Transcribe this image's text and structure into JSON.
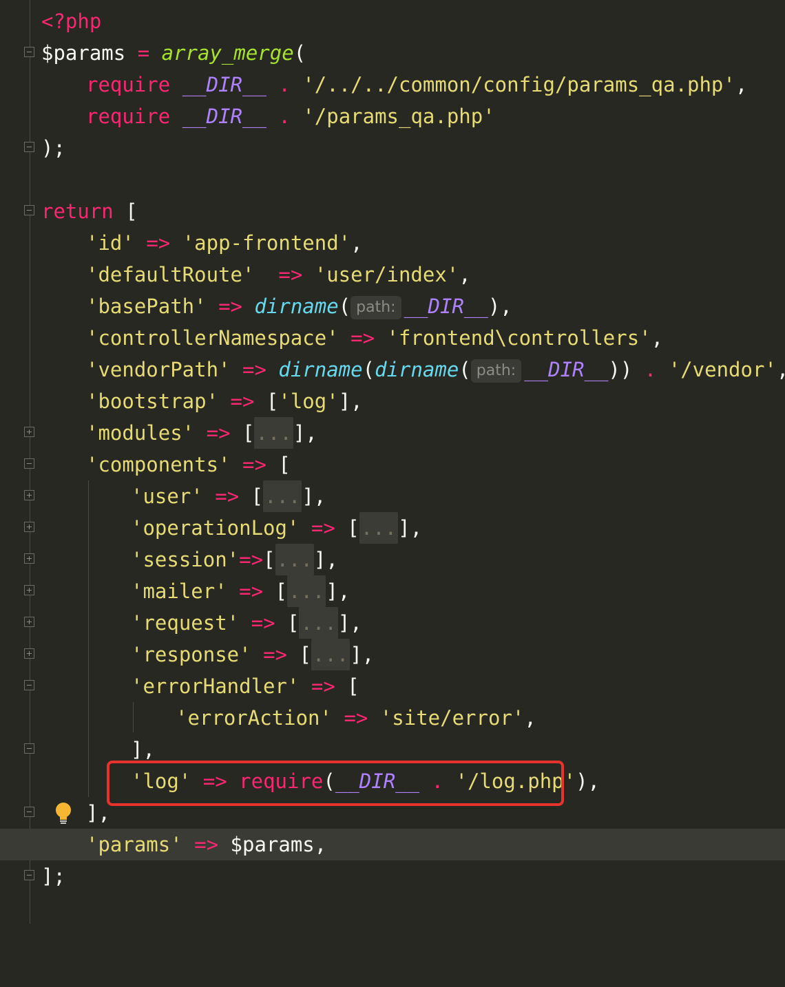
{
  "editor": {
    "lines": [
      {
        "t": "<?php"
      },
      {
        "t": "$params = array_merge("
      },
      {
        "t": "require __DIR__ . '/../../common/config/params_qa.php',"
      },
      {
        "t": "require __DIR__ . '/params_qa.php'"
      },
      {
        "t": ");"
      },
      {
        "t": ""
      },
      {
        "t": "return ["
      },
      {
        "t": "'id' => 'app-frontend',"
      },
      {
        "t": "'defaultRoute'  => 'user/index',"
      },
      {
        "t": "'basePath' => dirname( path: __DIR__),"
      },
      {
        "t": "'controllerNamespace' => 'frontend\\controllers',"
      },
      {
        "t": "'vendorPath' => dirname(dirname( path: __DIR__)) . '/vendor',"
      },
      {
        "t": "'bootstrap' => ['log'],"
      },
      {
        "t": "'modules' => [...],"
      },
      {
        "t": "'components' => ["
      },
      {
        "t": "'user' => [...],"
      },
      {
        "t": "'operationLog' => [...],"
      },
      {
        "t": "'session'=>[...],"
      },
      {
        "t": "'mailer' => [...],"
      },
      {
        "t": "'request' => [...],"
      },
      {
        "t": "'response' => [...],"
      },
      {
        "t": "'errorHandler' => ["
      },
      {
        "t": "'errorAction' => 'site/error',"
      },
      {
        "t": "],"
      },
      {
        "t": "'log' => require(__DIR__ . '/log.php'),"
      },
      {
        "t": "],"
      },
      {
        "t": "'params' => $params,"
      },
      {
        "t": "];"
      }
    ],
    "param_hint": "path:",
    "collapsed_marker": "...",
    "colors": {
      "background": "#272822",
      "keyword": "#f92672",
      "string": "#e6db74",
      "function": "#66d9ef",
      "constant": "#ae81ff",
      "highlight_border": "#e8332c"
    },
    "icons": [
      "fold-minus-icon",
      "fold-plus-icon",
      "lightbulb-icon"
    ]
  }
}
